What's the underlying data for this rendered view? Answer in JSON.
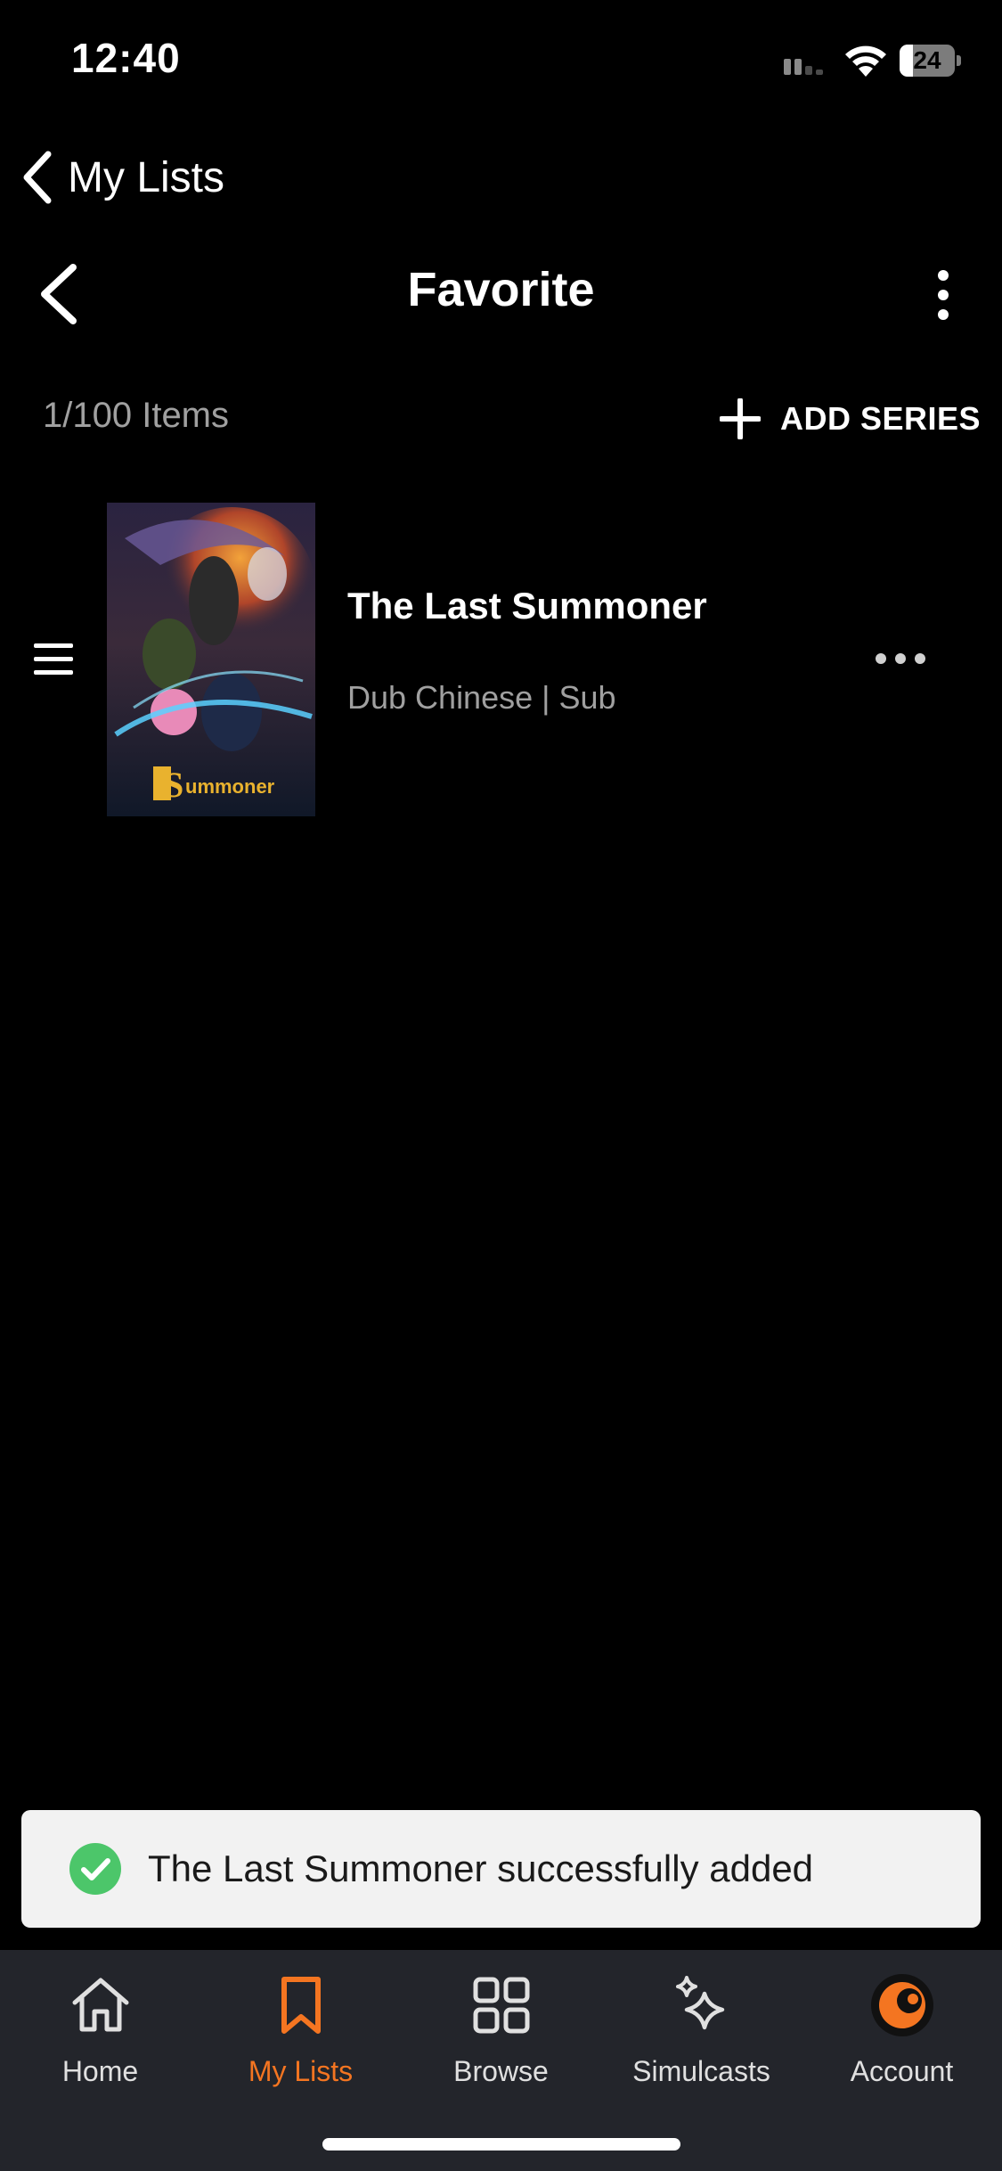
{
  "status_bar": {
    "time": "12:40",
    "battery_level": "24",
    "icons": [
      "signal-icon",
      "wifi-icon",
      "battery-icon"
    ]
  },
  "back_to_app": {
    "label": "My Lists",
    "icon": "chevron-left-icon"
  },
  "header": {
    "title": "Favorite",
    "back_icon": "chevron-left-icon",
    "menu_icon": "vertical-ellipsis-icon"
  },
  "list_info": {
    "count_text": "1/100 Items",
    "add_label": "ADD SERIES",
    "add_icon": "plus-icon"
  },
  "items": [
    {
      "title": "The Last Summoner",
      "meta": "Dub Chinese | Sub",
      "poster_alt": "The Last Summoner poster",
      "drag_icon": "drag-handle-icon",
      "more_icon": "horizontal-ellipsis-icon"
    }
  ],
  "toast": {
    "message": "The Last Summoner successfully added",
    "icon": "check-circle-icon"
  },
  "nav": {
    "items": [
      {
        "label": "Home",
        "icon": "home-icon",
        "active": false
      },
      {
        "label": "My Lists",
        "icon": "bookmark-icon",
        "active": true
      },
      {
        "label": "Browse",
        "icon": "grid-icon",
        "active": false
      },
      {
        "label": "Simulcasts",
        "icon": "sparkle-icon",
        "active": false
      },
      {
        "label": "Account",
        "icon": "crunchyroll-avatar-icon",
        "active": false
      }
    ]
  },
  "colors": {
    "background": "#000000",
    "accent": "#f47521",
    "nav_background": "#23252b",
    "toast_background": "#f2f2f2",
    "success_green": "#4cc66a",
    "muted_text": "#a0a0a0"
  }
}
